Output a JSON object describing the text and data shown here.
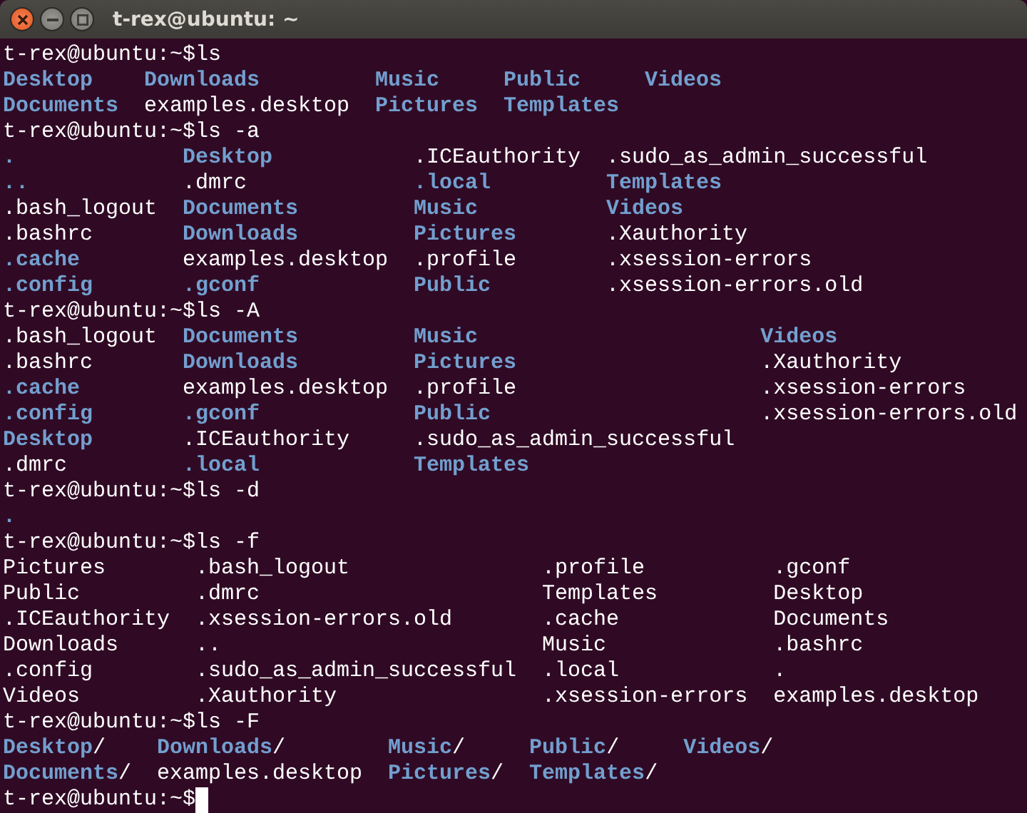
{
  "window": {
    "title": "t-rex@ubuntu: ~"
  },
  "session": [
    {
      "prompt": "t-rex@ubuntu:~$",
      "command": "ls",
      "rows": [
        [
          {
            "text": "Desktop",
            "kind": "dir"
          },
          {
            "text": "Downloads",
            "kind": "dir"
          },
          {
            "text": "Music",
            "kind": "dir"
          },
          {
            "text": "Public",
            "kind": "dir"
          },
          {
            "text": "Videos",
            "kind": "dir"
          }
        ],
        [
          {
            "text": "Documents",
            "kind": "dir"
          },
          {
            "text": "examples.desktop",
            "kind": "file"
          },
          {
            "text": "Pictures",
            "kind": "dir"
          },
          {
            "text": "Templates",
            "kind": "dir"
          }
        ]
      ]
    },
    {
      "prompt": "t-rex@ubuntu:~$",
      "command": "ls -a",
      "rows": [
        [
          {
            "text": ".",
            "kind": "dir"
          },
          {
            "text": "Desktop",
            "kind": "dir"
          },
          {
            "text": ".ICEauthority",
            "kind": "file"
          },
          {
            "text": ".sudo_as_admin_successful",
            "kind": "file"
          }
        ],
        [
          {
            "text": "..",
            "kind": "dir"
          },
          {
            "text": ".dmrc",
            "kind": "file"
          },
          {
            "text": ".local",
            "kind": "dir"
          },
          {
            "text": "Templates",
            "kind": "dir"
          }
        ],
        [
          {
            "text": ".bash_logout",
            "kind": "file"
          },
          {
            "text": "Documents",
            "kind": "dir"
          },
          {
            "text": "Music",
            "kind": "dir"
          },
          {
            "text": "Videos",
            "kind": "dir"
          }
        ],
        [
          {
            "text": ".bashrc",
            "kind": "file"
          },
          {
            "text": "Downloads",
            "kind": "dir"
          },
          {
            "text": "Pictures",
            "kind": "dir"
          },
          {
            "text": ".Xauthority",
            "kind": "file"
          }
        ],
        [
          {
            "text": ".cache",
            "kind": "dir"
          },
          {
            "text": "examples.desktop",
            "kind": "file"
          },
          {
            "text": ".profile",
            "kind": "file"
          },
          {
            "text": ".xsession-errors",
            "kind": "file"
          }
        ],
        [
          {
            "text": ".config",
            "kind": "dir"
          },
          {
            "text": ".gconf",
            "kind": "dir"
          },
          {
            "text": "Public",
            "kind": "dir"
          },
          {
            "text": ".xsession-errors.old",
            "kind": "file"
          }
        ]
      ]
    },
    {
      "prompt": "t-rex@ubuntu:~$",
      "command": "ls -A",
      "rows": [
        [
          {
            "text": ".bash_logout",
            "kind": "file"
          },
          {
            "text": "Documents",
            "kind": "dir"
          },
          {
            "text": "Music",
            "kind": "dir"
          },
          {
            "text": "Videos",
            "kind": "dir"
          }
        ],
        [
          {
            "text": ".bashrc",
            "kind": "file"
          },
          {
            "text": "Downloads",
            "kind": "dir"
          },
          {
            "text": "Pictures",
            "kind": "dir"
          },
          {
            "text": ".Xauthority",
            "kind": "file"
          }
        ],
        [
          {
            "text": ".cache",
            "kind": "dir"
          },
          {
            "text": "examples.desktop",
            "kind": "file"
          },
          {
            "text": ".profile",
            "kind": "file"
          },
          {
            "text": ".xsession-errors",
            "kind": "file"
          }
        ],
        [
          {
            "text": ".config",
            "kind": "dir"
          },
          {
            "text": ".gconf",
            "kind": "dir"
          },
          {
            "text": "Public",
            "kind": "dir"
          },
          {
            "text": ".xsession-errors.old",
            "kind": "file"
          }
        ],
        [
          {
            "text": "Desktop",
            "kind": "dir"
          },
          {
            "text": ".ICEauthority",
            "kind": "file"
          },
          {
            "text": ".sudo_as_admin_successful",
            "kind": "file"
          }
        ],
        [
          {
            "text": ".dmrc",
            "kind": "file"
          },
          {
            "text": ".local",
            "kind": "dir"
          },
          {
            "text": "Templates",
            "kind": "dir"
          }
        ]
      ]
    },
    {
      "prompt": "t-rex@ubuntu:~$",
      "command": "ls -d",
      "rows": [
        [
          {
            "text": ".",
            "kind": "dir"
          }
        ]
      ]
    },
    {
      "prompt": "t-rex@ubuntu:~$",
      "command": "ls -f",
      "rows": [
        [
          {
            "text": "Pictures",
            "kind": "file"
          },
          {
            "text": ".bash_logout",
            "kind": "file"
          },
          {
            "text": ".profile",
            "kind": "file"
          },
          {
            "text": ".gconf",
            "kind": "file"
          }
        ],
        [
          {
            "text": "Public",
            "kind": "file"
          },
          {
            "text": ".dmrc",
            "kind": "file"
          },
          {
            "text": "Templates",
            "kind": "file"
          },
          {
            "text": "Desktop",
            "kind": "file"
          }
        ],
        [
          {
            "text": ".ICEauthority",
            "kind": "file"
          },
          {
            "text": ".xsession-errors.old",
            "kind": "file"
          },
          {
            "text": ".cache",
            "kind": "file"
          },
          {
            "text": "Documents",
            "kind": "file"
          }
        ],
        [
          {
            "text": "Downloads",
            "kind": "file"
          },
          {
            "text": "..",
            "kind": "file"
          },
          {
            "text": "Music",
            "kind": "file"
          },
          {
            "text": ".bashrc",
            "kind": "file"
          }
        ],
        [
          {
            "text": ".config",
            "kind": "file"
          },
          {
            "text": ".sudo_as_admin_successful",
            "kind": "file"
          },
          {
            "text": ".local",
            "kind": "file"
          },
          {
            "text": ".",
            "kind": "file"
          }
        ],
        [
          {
            "text": "Videos",
            "kind": "file"
          },
          {
            "text": ".Xauthority",
            "kind": "file"
          },
          {
            "text": ".xsession-errors",
            "kind": "file"
          },
          {
            "text": "examples.desktop",
            "kind": "file"
          }
        ]
      ]
    },
    {
      "prompt": "t-rex@ubuntu:~$",
      "command": "ls -F",
      "rows": [
        [
          {
            "text": "Desktop",
            "kind": "dir",
            "suffix": "/"
          },
          {
            "text": "Downloads",
            "kind": "dir",
            "suffix": "/"
          },
          {
            "text": "Music",
            "kind": "dir",
            "suffix": "/"
          },
          {
            "text": "Public",
            "kind": "dir",
            "suffix": "/"
          },
          {
            "text": "Videos",
            "kind": "dir",
            "suffix": "/"
          }
        ],
        [
          {
            "text": "Documents",
            "kind": "dir",
            "suffix": "/"
          },
          {
            "text": "examples.desktop",
            "kind": "file"
          },
          {
            "text": "Pictures",
            "kind": "dir",
            "suffix": "/"
          },
          {
            "text": "Templates",
            "kind": "dir",
            "suffix": "/"
          }
        ]
      ]
    },
    {
      "prompt": "t-rex@ubuntu:~$"
    }
  ],
  "cursor_shown": true
}
